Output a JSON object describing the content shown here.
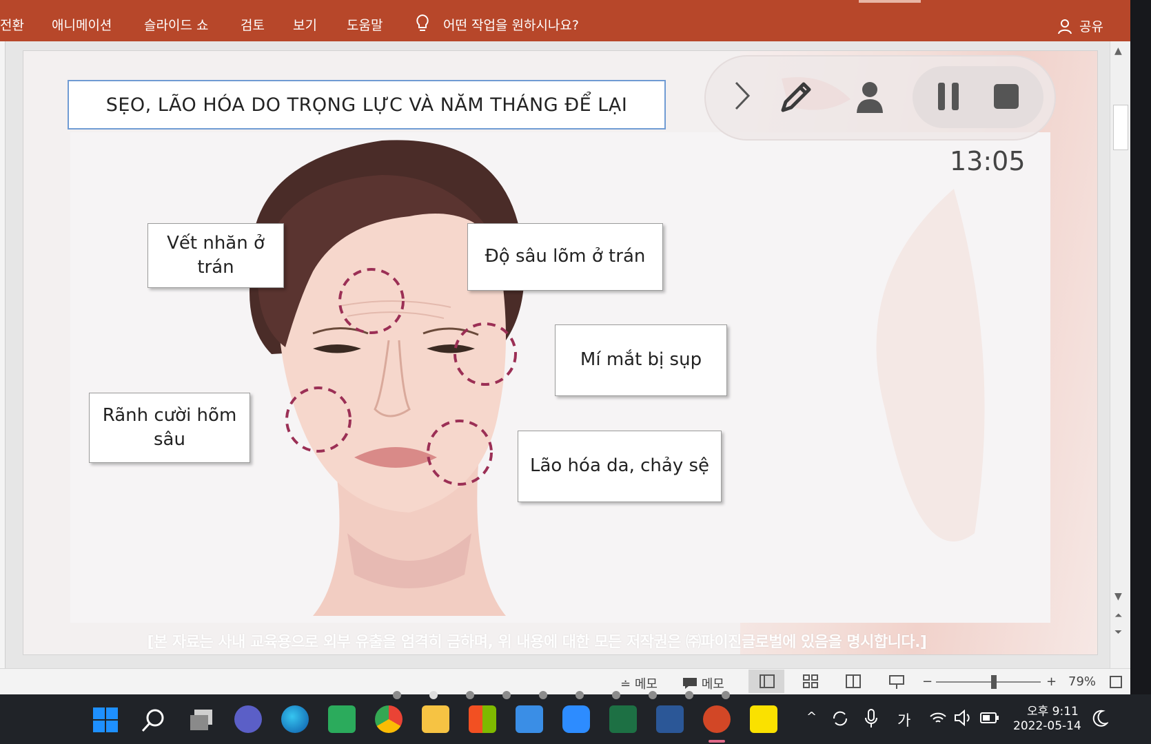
{
  "ribbon": {
    "tabs": [
      "전환",
      "애니메이션",
      "슬라이드 쇼",
      "검토",
      "보기",
      "도움말"
    ],
    "tell_me": "어떤 작업을 원하시나요?",
    "share": "공유"
  },
  "slide": {
    "title": "SẸO, LÃO HÓA DO TRỌNG LỰC VÀ NĂM THÁNG ĐỂ LẠI",
    "labels": {
      "forehead_wrinkles": "Vết nhăn ở trán",
      "forehead_depth": "Độ sâu lõm ở trán",
      "eyelid": "Mí mắt bị sụp",
      "smile_lines": "Rãnh cười hõm sâu",
      "sagging": "Lão hóa da, chảy sệ"
    },
    "disclaimer": "[본 자료는 사내 교육용으로 외부 유출을 엄격히 금하며, 위 내용에 대한 모든 저작권은 ㈜파이진글로벌에 있음을 명시합니다.]"
  },
  "presenter": {
    "timer": "13:05"
  },
  "statusbar": {
    "notes1": "메모",
    "notes2": "메모",
    "zoom_minus": "−",
    "zoom_plus": "+",
    "zoom_level": "79%",
    "zoom_fraction": 0.55
  },
  "taskbar": {
    "ime": "가",
    "time": "오후 9:11",
    "date": "2022-05-14",
    "apps": [
      "start-icon",
      "search-icon",
      "task-view-icon",
      "teams-icon",
      "edge-icon",
      "sync-app-icon",
      "chrome-icon",
      "file-explorer-icon",
      "store-icon",
      "mail-icon",
      "zoom-icon",
      "excel-icon",
      "word-icon",
      "powerpoint-icon",
      "kakaotalk-icon"
    ]
  },
  "colors": {
    "ribbon": "#b7472a",
    "title_border": "#6f9bd3",
    "dashed_circle": "#9b2f55",
    "taskbar": "#202328"
  }
}
